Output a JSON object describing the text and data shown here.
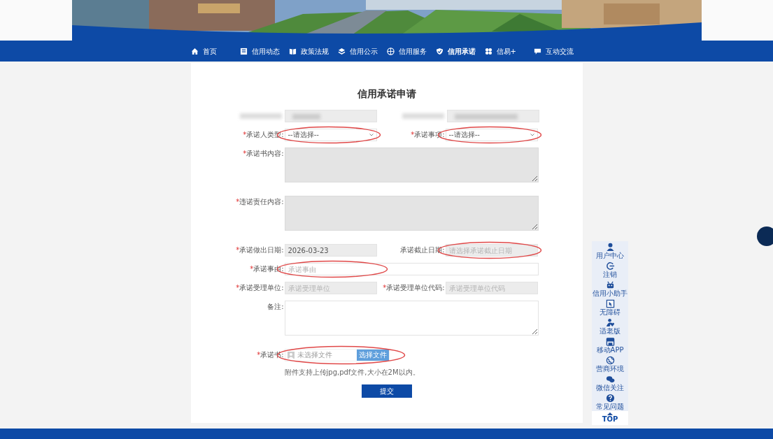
{
  "nav": [
    {
      "label": "首页",
      "selected": false
    },
    {
      "label": "信用动态",
      "selected": false
    },
    {
      "label": "政策法规",
      "selected": false
    },
    {
      "label": "信用公示",
      "selected": false
    },
    {
      "label": "信用服务",
      "selected": false
    },
    {
      "label": "信用承诺",
      "selected": true
    },
    {
      "label": "信易+",
      "selected": false
    },
    {
      "label": "互动交流",
      "selected": false
    }
  ],
  "form": {
    "title": "信用承诺申请",
    "rows": [
      {
        "kind": "redacted"
      },
      {
        "kind": "pair",
        "items": [
          {
            "mark": "*",
            "label": "承诺人类型:",
            "kind": "select",
            "value": "--请选择--",
            "disabled": false,
            "circled": true
          },
          {
            "mark": "*",
            "label": "承诺事项:",
            "kind": "select",
            "value": "--请选择--",
            "disabled": false,
            "circled": true
          }
        ]
      },
      {
        "kind": "full",
        "item": {
          "mark": "*",
          "label": "承诺书内容:",
          "kind": "textarea",
          "disabled": true,
          "circled": false
        }
      },
      {
        "kind": "full",
        "item": {
          "mark": "*",
          "label": "违诺责任内容:",
          "kind": "textarea",
          "disabled": true,
          "circled": false
        }
      },
      {
        "kind": "pair",
        "items": [
          {
            "mark": "*",
            "label": "承诺做出日期:",
            "kind": "input",
            "value": "2026-03-23",
            "disabled": true,
            "circled": false
          },
          {
            "label": "承诺截止日期:",
            "kind": "input",
            "placeholder": "请选择承诺截止日期",
            "disabled": true,
            "circled": true
          }
        ]
      },
      {
        "kind": "full",
        "item": {
          "mark": "*",
          "label": "承诺事由:",
          "kind": "input",
          "placeholder": "承诺事由",
          "disabled": false,
          "circled": true
        }
      },
      {
        "kind": "pair",
        "items": [
          {
            "mark": "*",
            "label": "承诺受理单位:",
            "kind": "input",
            "placeholder": "承诺受理单位",
            "disabled": true,
            "circled": false
          },
          {
            "mark": "*",
            "label": "承诺受理单位代码:",
            "kind": "input",
            "placeholder": "承诺受理单位代码",
            "disabled": true,
            "circled": false
          }
        ]
      },
      {
        "kind": "full",
        "item": {
          "label": "备注:",
          "kind": "textarea",
          "disabled": false,
          "circled": false
        }
      },
      {
        "kind": "full",
        "item": {
          "mark": "*",
          "label": "承诺书:",
          "kind": "file",
          "placeholder": "未选择文件",
          "button": "选择文件",
          "hint": "附件支持上传jpg,pdf文件,大小在2M以内。",
          "disabled": false,
          "circled": true
        }
      }
    ],
    "submit": "提交"
  },
  "side_tools": [
    {
      "label": "用户中心"
    },
    {
      "label": "注销"
    },
    {
      "label": "信用小助手"
    },
    {
      "label": "无障碍"
    },
    {
      "label": "适老版"
    },
    {
      "label": "移动APP"
    },
    {
      "label": "营商环境"
    },
    {
      "label": "微信关注"
    },
    {
      "label": "常见问题"
    }
  ],
  "top_button": "TOP"
}
